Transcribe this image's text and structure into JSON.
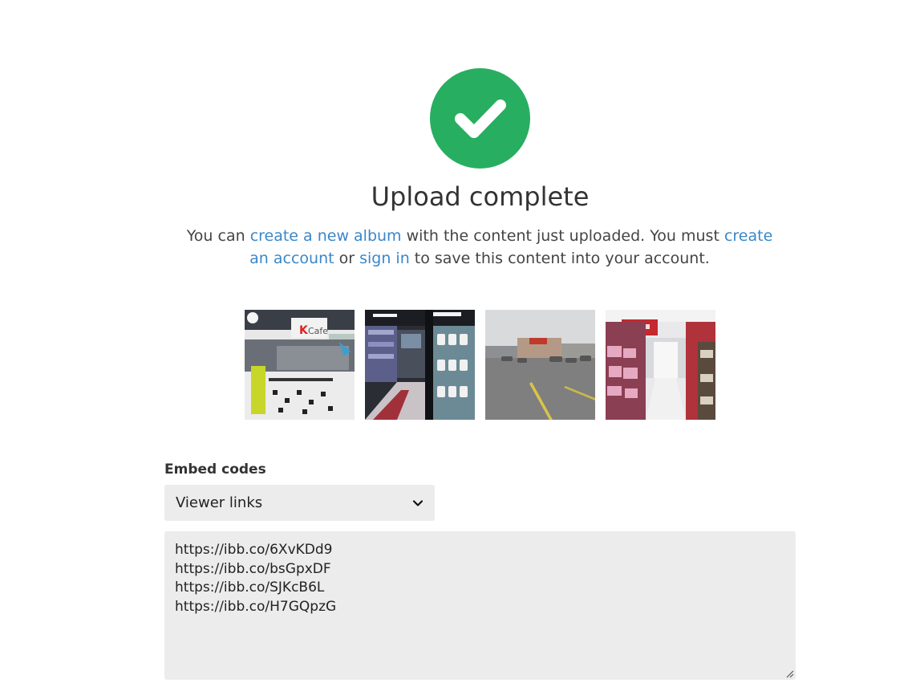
{
  "status": {
    "icon": "checkmark-icon",
    "color": "#27ae60",
    "title": "Upload complete"
  },
  "message": {
    "part1": "You can ",
    "link_album": "create a new album",
    "part2": " with the content just uploaded. You must ",
    "link_account": "create an account",
    "part3": " or ",
    "link_signin": "sign in",
    "part4": " to save this content into your account."
  },
  "thumbnails": [
    {
      "name": "kcafe-store-interior"
    },
    {
      "name": "store-aisle-freezer"
    },
    {
      "name": "kmart-parking-lot"
    },
    {
      "name": "store-toy-aisle"
    }
  ],
  "embed": {
    "label": "Embed codes",
    "selected": "Viewer links",
    "links": [
      "https://ibb.co/6XvKDd9",
      "https://ibb.co/bsGpxDF",
      "https://ibb.co/SJKcB6L",
      "https://ibb.co/H7GQpzG"
    ]
  },
  "colors": {
    "link": "#3a87c8",
    "field_bg": "#ececec"
  }
}
